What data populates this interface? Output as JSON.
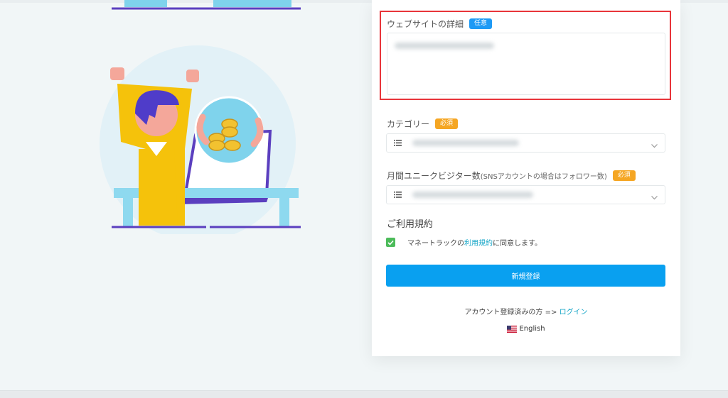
{
  "form": {
    "website_details": {
      "label": "ウェブサイトの詳細",
      "badge": "任意"
    },
    "category": {
      "label": "カテゴリー",
      "badge": "必須"
    },
    "visitors": {
      "label": "月間ユニークビジター数",
      "note": "(SNSアカウントの場合はフォロワー数)",
      "badge": "必須"
    },
    "terms": {
      "title": "ご利用規約",
      "text_before": "マネートラックの",
      "link": "利用規約",
      "text_after": "に同意します。",
      "checked": true
    },
    "submit_label": "新規登録",
    "login": {
      "text": "アカウント登録済みの方 => ",
      "link": "ログイン"
    },
    "language": {
      "label": "English",
      "icon": "us-flag-icon"
    }
  },
  "colors": {
    "accent": "#09a0f0",
    "badge_optional": "#1e9af5",
    "badge_required": "#f5a623",
    "checkbox": "#4cbb5a",
    "link": "#1aa7c8",
    "highlight": "#e8353a"
  }
}
